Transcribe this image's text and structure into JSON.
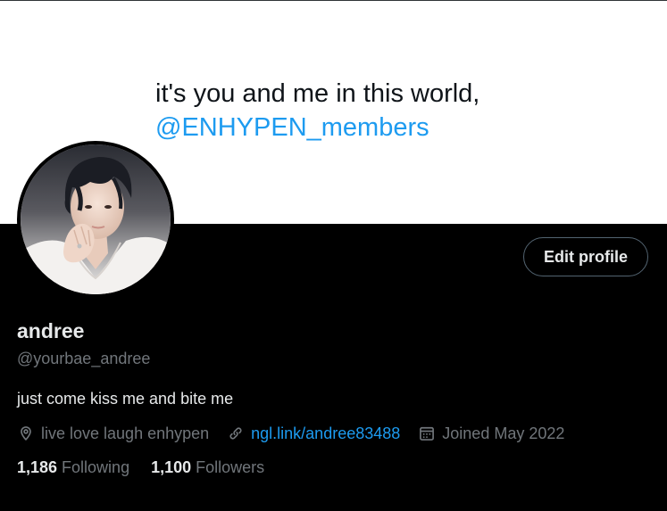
{
  "banner": {
    "tweet_line1": "it's you and me in this world,",
    "tweet_mention": "@ENHYPEN_members"
  },
  "profile": {
    "display_name": "andree",
    "handle": "@yourbae_andree",
    "bio": "just come kiss me and bite me",
    "location": "live love laugh enhypen",
    "link": "ngl.link/andree83488",
    "joined": "Joined May 2022",
    "edit_button_label": "Edit profile"
  },
  "stats": {
    "following_count": "1,186",
    "following_label": "Following",
    "followers_count": "1,100",
    "followers_label": "Followers"
  },
  "icons": {
    "location": "location-pin-icon",
    "link": "link-icon",
    "calendar": "calendar-icon"
  },
  "colors": {
    "background": "#000000",
    "banner_bg": "#ffffff",
    "primary_text": "#e7e9ea",
    "secondary_text": "#71767b",
    "accent": "#1d9bf0",
    "button_border": "#536471"
  }
}
